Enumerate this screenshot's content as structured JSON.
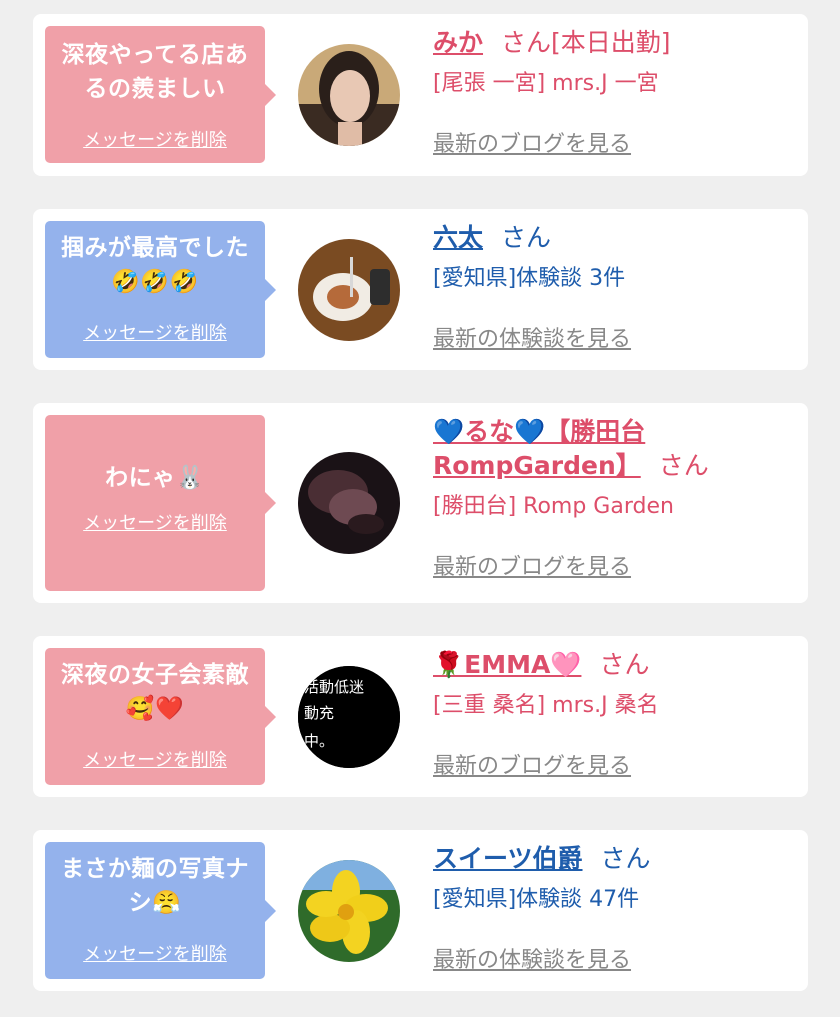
{
  "colors": {
    "pink_bubble": "#f0a0a8",
    "blue_bubble": "#94b2ec",
    "pink_text": "#dd4e6a",
    "blue_text": "#1f5dac",
    "link_gray": "#888888"
  },
  "delete_label": "メッセージを削除",
  "honorific": "さん",
  "entries": [
    {
      "bubble_text": "深夜やってる店あるの羨ましい",
      "name": "みか",
      "status": "[本日出勤]",
      "sub": "[尾張 一宮] mrs.J 一宮",
      "link": "最新のブログを見る"
    },
    {
      "bubble_text": "掴みが最高でした🤣🤣🤣",
      "name": "六太",
      "status": "",
      "sub": "[愛知県]体験談 3件",
      "link": "最新の体験談を見る"
    },
    {
      "bubble_text": "わにゃ🐰",
      "name": "💙るな💙【勝田台RompGarden】",
      "status": "",
      "sub": "[勝田台] Romp Garden",
      "link": "最新のブログを見る"
    },
    {
      "bubble_text": "深夜の女子会素敵🥰❤️",
      "name": "🌹EMMA🩷",
      "status": "",
      "sub": "[三重 桑名] mrs.J 桑名",
      "link": "最新のブログを見る"
    },
    {
      "bubble_text": "まさか麺の写真ナシ😤",
      "name": "スイーツ伯爵",
      "status": "",
      "sub": "[愛知県]体験談 47件",
      "link": "最新の体験談を見る"
    }
  ],
  "avatar4_text": [
    "活動低迷",
    "動充",
    "中。"
  ]
}
